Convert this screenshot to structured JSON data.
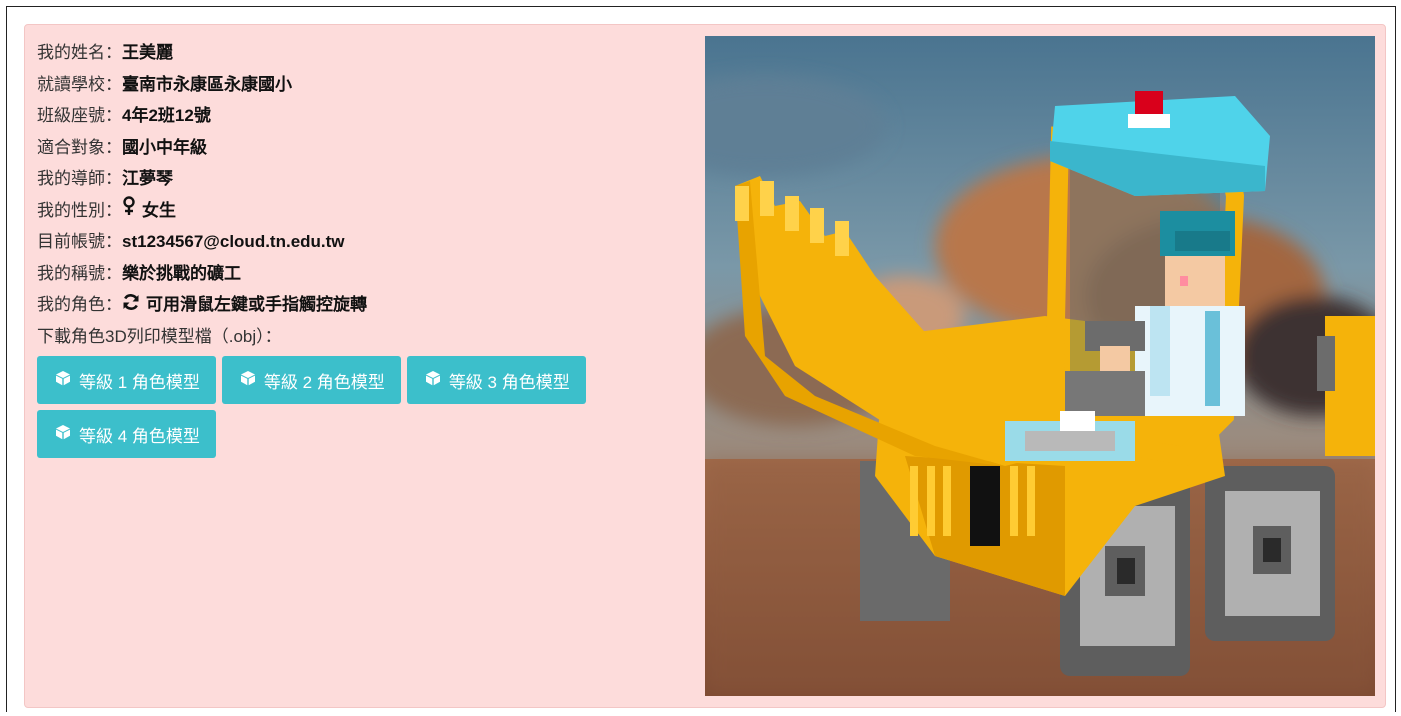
{
  "profile": {
    "name": {
      "label": "我的姓名：",
      "value": "王美麗"
    },
    "school": {
      "label": "就讀學校：",
      "value": "臺南市永康區永康國小"
    },
    "seat": {
      "label": "班級座號：",
      "value": "4年2班12號"
    },
    "audience": {
      "label": "適合對象：",
      "value": "國小中年級"
    },
    "teacher": {
      "label": "我的導師：",
      "value": "江夢琴"
    },
    "gender": {
      "label": "我的性別：",
      "value": "女生",
      "icon": "venus-icon"
    },
    "account": {
      "label": "目前帳號：",
      "value": "st1234567@cloud.tn.edu.tw"
    },
    "title": {
      "label": "我的稱號：",
      "value": "樂於挑戰的礦工"
    },
    "role": {
      "label": "我的角色：",
      "value": "可用滑鼠左鍵或手指觸控旋轉",
      "icon": "rotate-icon"
    },
    "download_label": "下載角色3D列印模型檔（.obj）："
  },
  "buttons": [
    {
      "label": "等級 1 角色模型",
      "icon": "cube-icon"
    },
    {
      "label": "等級 2 角色模型",
      "icon": "cube-icon"
    },
    {
      "label": "等級 3 角色模型",
      "icon": "cube-icon"
    },
    {
      "label": "等級 4 角色模型",
      "icon": "cube-icon"
    }
  ],
  "colors": {
    "card_background": "#fddcdb",
    "button_background": "#3cbfcb",
    "button_text": "#ffffff",
    "bulldozer_yellow": "#f5b30a",
    "cab_roof": "#4fd3ea"
  }
}
